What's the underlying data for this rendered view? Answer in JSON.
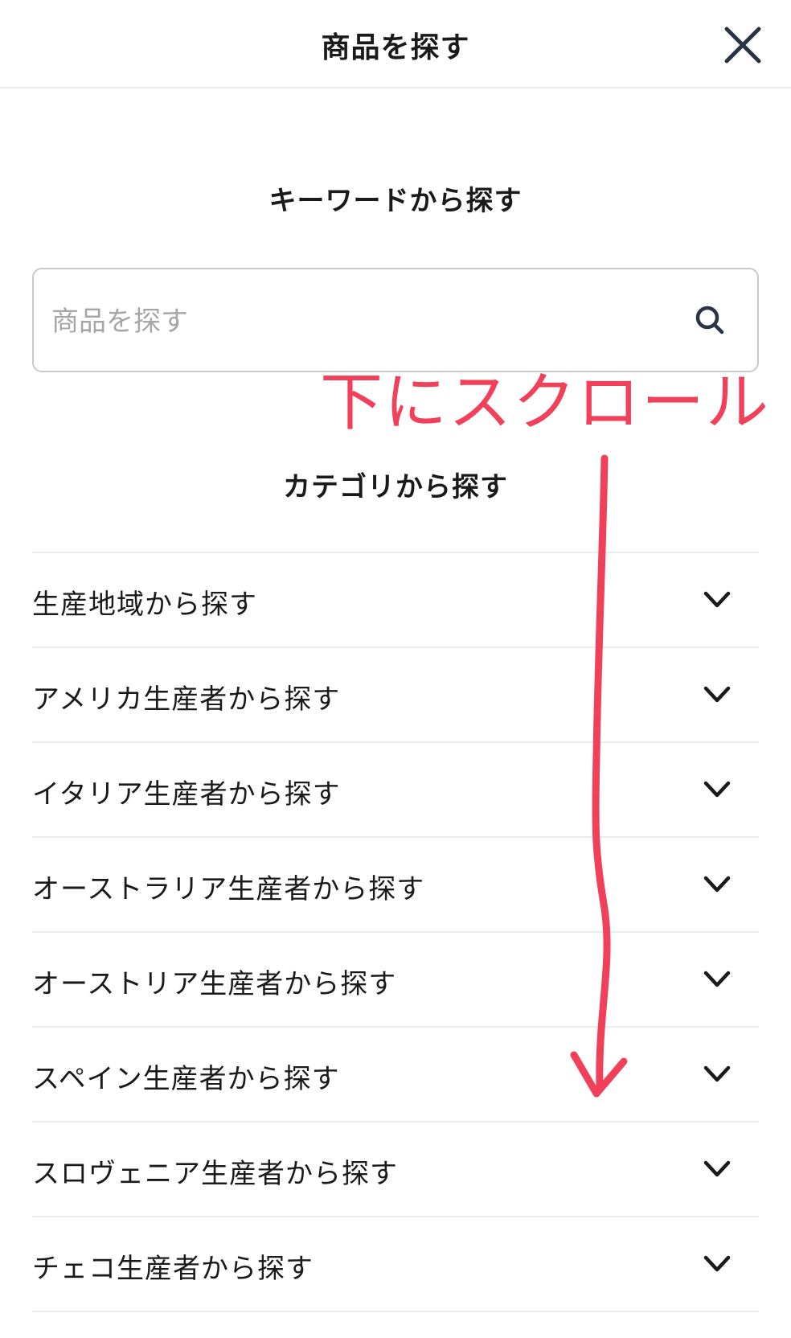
{
  "header": {
    "title": "商品を探す",
    "close_icon": "close-icon"
  },
  "keyword_section": {
    "title": "キーワードから探す",
    "search_placeholder": "商品を探す",
    "search_value": "",
    "search_icon": "search-icon"
  },
  "category_section": {
    "title": "カテゴリから探す",
    "items": [
      {
        "label": "生産地域から探す"
      },
      {
        "label": "アメリカ生産者から探す"
      },
      {
        "label": "イタリア生産者から探す"
      },
      {
        "label": "オーストラリア生産者から探す"
      },
      {
        "label": "オーストリア生産者から探す"
      },
      {
        "label": "スペイン生産者から探す"
      },
      {
        "label": "スロヴェニア生産者から探す"
      },
      {
        "label": "チェコ生産者から探す"
      }
    ],
    "chevron_icon": "chevron-down-icon"
  },
  "annotation": {
    "text": "下にスクロール",
    "color": "#f0405a",
    "arrow_icon": "hand-drawn-down-arrow"
  },
  "colors": {
    "text": "#1a1a1a",
    "divider": "#ececec",
    "border": "#c9c9c9",
    "icon": "#2b3444",
    "annotation": "#f0405a"
  }
}
